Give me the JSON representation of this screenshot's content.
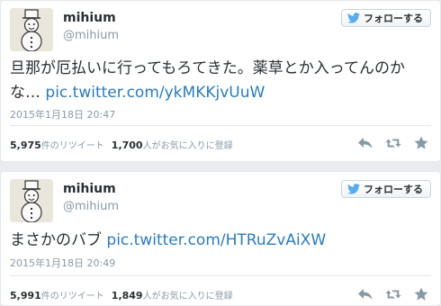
{
  "colors": {
    "link": "#2b7bb9",
    "meta": "#8899a6",
    "text": "#292f33",
    "twitter_blue": "#55acee"
  },
  "tweets": [
    {
      "user": {
        "name": "mihium",
        "handle": "@mihium",
        "avatar_icon": "snowman-avatar"
      },
      "follow_button": {
        "label": "フォローする",
        "icon": "twitter-bird-icon"
      },
      "text": "旦那が厄払いに行ってもろてきた。薬草とか入ってんのかな…",
      "link": "pic.twitter.com/ykMKKjvUuW",
      "timestamp": "2015年1月18日 20:47",
      "stats": {
        "retweets": "5,975",
        "retweets_label": "件のリツイート",
        "favorites": "1,700",
        "favorites_label": "人がお気に入りに登録"
      },
      "actions": {
        "reply_icon": "reply-icon",
        "retweet_icon": "retweet-icon",
        "favorite_icon": "favorite-star-icon"
      }
    },
    {
      "user": {
        "name": "mihium",
        "handle": "@mihium",
        "avatar_icon": "snowman-avatar"
      },
      "follow_button": {
        "label": "フォローする",
        "icon": "twitter-bird-icon"
      },
      "text": "まさかのバブ",
      "link": "pic.twitter.com/HTRuZvAiXW",
      "timestamp": "2015年1月18日 20:49",
      "stats": {
        "retweets": "5,991",
        "retweets_label": "件のリツイート",
        "favorites": "1,849",
        "favorites_label": "人がお気に入りに登録"
      },
      "actions": {
        "reply_icon": "reply-icon",
        "retweet_icon": "retweet-icon",
        "favorite_icon": "favorite-star-icon"
      }
    }
  ]
}
